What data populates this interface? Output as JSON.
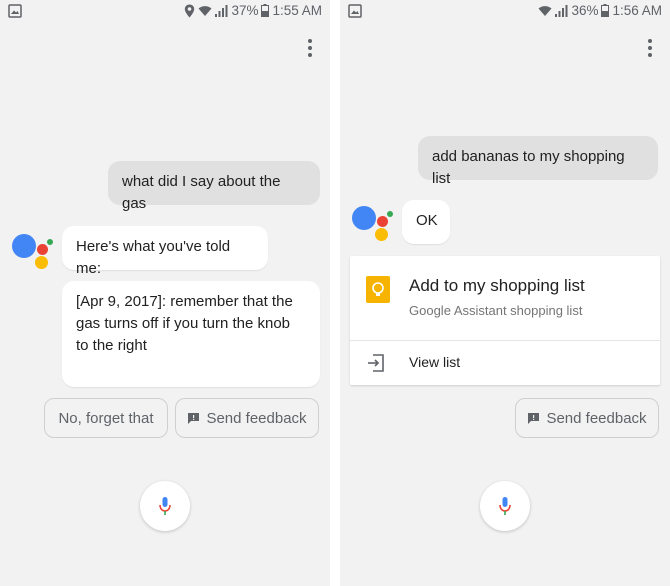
{
  "left_screen": {
    "status": {
      "battery": "37%",
      "time": "1:55 AM"
    },
    "user_query": "what did I say about the gas",
    "assistant_reply": "Here's what you've told me:",
    "memory_lines": [
      "[Apr 9, 2017]: remember that the",
      "gas turns off if you turn the knob",
      "to the right"
    ],
    "suggestions": {
      "forget": "No, forget that",
      "feedback": "Send feedback"
    }
  },
  "right_screen": {
    "status": {
      "battery": "36%",
      "time": "1:56 AM"
    },
    "user_query": "add bananas to my shopping list",
    "assistant_reply": "OK",
    "card": {
      "title": "Add to my shopping list",
      "subtitle": "Google Assistant shopping list",
      "action": "View list"
    },
    "suggestions": {
      "feedback": "Send feedback"
    }
  },
  "colors": {
    "assistant_blue": "#4285f4",
    "assistant_red": "#ea4335",
    "assistant_yellow": "#fbbc04",
    "assistant_green": "#34a853",
    "keep_yellow": "#f6b400"
  },
  "icons": [
    "image-icon",
    "location-icon",
    "wifi-icon",
    "signal-icon",
    "battery-icon",
    "overflow-menu-icon",
    "feedback-icon",
    "microphone-icon",
    "keep-lightbulb-icon",
    "open-list-icon"
  ]
}
